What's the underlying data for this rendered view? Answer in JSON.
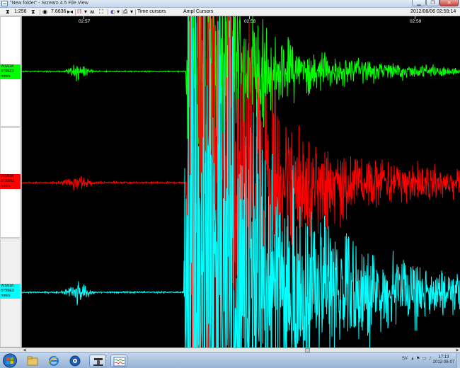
{
  "window": {
    "title": "\"New folder\" - Scream 4.5 File View",
    "minimize_glyph": "▁",
    "maximize_glyph": "❐",
    "close_glyph": "✕"
  },
  "toolbar": {
    "zoom_out_value": "1:256",
    "zoom_in_value": "7.6636",
    "time_cursors_label": "Time cursors",
    "ampl_cursors_label": "Ampl Cursors",
    "timestamp": "2012/08/06 02:59:14",
    "icons": [
      "fit-icon",
      "expand-icon",
      "eye-icon",
      "play-stop-icon",
      "filter-icon",
      "waveform-icon",
      "grid-icon",
      "spectrum-icon",
      "print-icon"
    ]
  },
  "channels": [
    {
      "lines": [
        "WS918",
        "8799Z2",
        "mm/s"
      ],
      "color": "#00ff00"
    },
    {
      "lines": [
        "WS918",
        "8799N2",
        "mm/s"
      ],
      "color": "#ff0000"
    },
    {
      "lines": [
        "WS918",
        "8799E2",
        "mm/s"
      ],
      "color": "#00ffff"
    }
  ],
  "time_axis": {
    "labels": [
      "02:57",
      "02:58",
      "02:59"
    ]
  },
  "taskbar": {
    "apps": [
      "start-orb",
      "explorer-icon",
      "internet-explorer-icon",
      "media-player-icon",
      "network-app-icon",
      "scream-app-icon"
    ],
    "tray_language": "SV",
    "clock_time": "17:13",
    "clock_date": "2012-08-07"
  },
  "colors": {
    "trace_z": "#00ff00",
    "trace_n": "#ff0000",
    "trace_e": "#00ffff",
    "plot_background": "#000000"
  }
}
